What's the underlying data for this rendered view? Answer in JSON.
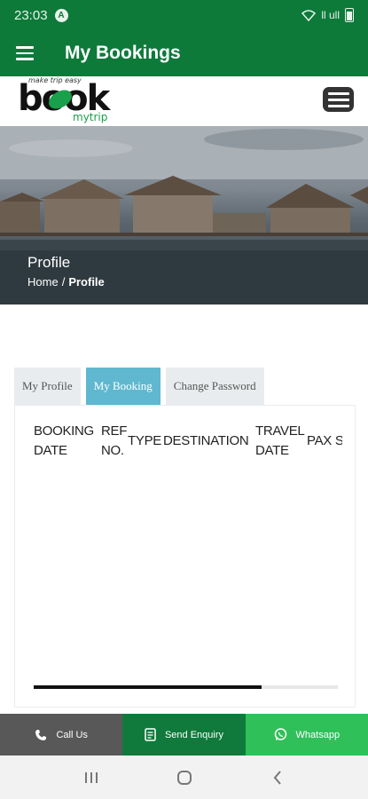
{
  "status_bar": {
    "time": "23:03",
    "nav_icon": "A",
    "signal_text": "ll ull"
  },
  "app_bar": {
    "title": "My Bookings"
  },
  "logo": {
    "tagline": "make trip easy",
    "word": "book",
    "sub": "mytrip"
  },
  "hero": {
    "title": "Profile",
    "breadcrumb_home": "Home",
    "breadcrumb_sep": "/",
    "breadcrumb_current": "Profile"
  },
  "tabs": [
    {
      "label": "My Profile"
    },
    {
      "label": "My Booking"
    },
    {
      "label": "Change Password"
    }
  ],
  "table": {
    "headers": [
      "BOOKING DATE",
      "REF NO.",
      "TYPE",
      "DESTINATION",
      "TRAVEL DATE",
      "PAX S"
    ],
    "scroll_fraction": 0.75
  },
  "actions": {
    "call": "Call Us",
    "enquiry": "Send Enquiry",
    "whatsapp": "Whatsapp"
  },
  "colors": {
    "primary": "#0d7a3a",
    "tab_active": "#5fb8cf",
    "whatsapp": "#2fc05a",
    "call": "#585858"
  },
  "icons": {
    "menu": "hamburger-icon",
    "phone": "phone-icon",
    "doc": "document-icon",
    "whatsapp": "whatsapp-icon"
  }
}
